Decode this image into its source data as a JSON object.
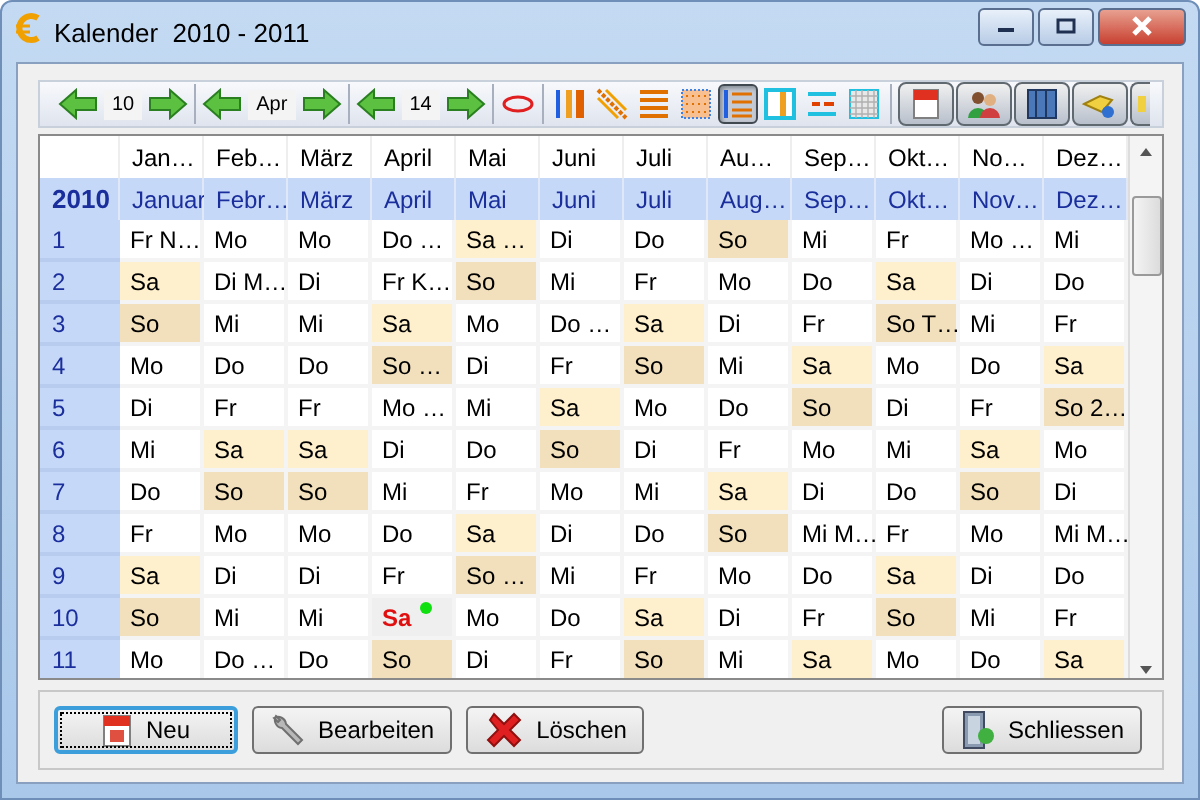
{
  "window": {
    "title": "Kalender  2010 - 2011"
  },
  "toolbar": {
    "navigators": [
      {
        "value": "10"
      },
      {
        "value": "Apr"
      },
      {
        "value": "14"
      }
    ],
    "views": [
      {
        "selected": false
      },
      {
        "selected": false
      },
      {
        "selected": false
      },
      {
        "selected": false
      },
      {
        "selected": true
      },
      {
        "selected": false
      },
      {
        "selected": false
      },
      {
        "selected": false
      }
    ]
  },
  "table": {
    "columns": [
      "Jan…",
      "Feb…",
      "März",
      "April",
      "Mai",
      "Juni",
      "Juli",
      "Au…",
      "Sep…",
      "Okt…",
      "No…",
      "Dez…"
    ],
    "year_row": {
      "year": "2010",
      "months": [
        "Januar",
        "Febr…",
        "März",
        "April",
        "Mai",
        "Juni",
        "Juli",
        "Aug…",
        "Sep…",
        "Okt…",
        "Nov…",
        "Dez…"
      ]
    },
    "rows": [
      {
        "day": "1",
        "cells": [
          {
            "text": "Fr N…",
            "kind": "day"
          },
          {
            "text": "Mo",
            "kind": "day"
          },
          {
            "text": "Mo",
            "kind": "day"
          },
          {
            "text": "Do …",
            "kind": "day"
          },
          {
            "text": "Sa …",
            "kind": "sat"
          },
          {
            "text": "Di",
            "kind": "day"
          },
          {
            "text": "Do",
            "kind": "day"
          },
          {
            "text": "So",
            "kind": "sun"
          },
          {
            "text": "Mi",
            "kind": "day"
          },
          {
            "text": "Fr",
            "kind": "day"
          },
          {
            "text": "Mo …",
            "kind": "day"
          },
          {
            "text": "Mi",
            "kind": "day"
          }
        ]
      },
      {
        "day": "2",
        "cells": [
          {
            "text": "Sa",
            "kind": "sat"
          },
          {
            "text": "Di M…",
            "kind": "day"
          },
          {
            "text": "Di",
            "kind": "day"
          },
          {
            "text": "Fr K…",
            "kind": "day"
          },
          {
            "text": "So",
            "kind": "sun"
          },
          {
            "text": "Mi",
            "kind": "day"
          },
          {
            "text": "Fr",
            "kind": "day"
          },
          {
            "text": "Mo",
            "kind": "day"
          },
          {
            "text": "Do",
            "kind": "day"
          },
          {
            "text": "Sa",
            "kind": "sat"
          },
          {
            "text": "Di",
            "kind": "day"
          },
          {
            "text": "Do",
            "kind": "day"
          }
        ]
      },
      {
        "day": "3",
        "cells": [
          {
            "text": "So",
            "kind": "sun"
          },
          {
            "text": "Mi",
            "kind": "day"
          },
          {
            "text": "Mi",
            "kind": "day"
          },
          {
            "text": "Sa",
            "kind": "sat"
          },
          {
            "text": "Mo",
            "kind": "day"
          },
          {
            "text": "Do …",
            "kind": "day"
          },
          {
            "text": "Sa",
            "kind": "sat"
          },
          {
            "text": "Di",
            "kind": "day"
          },
          {
            "text": "Fr",
            "kind": "day"
          },
          {
            "text": "So T…",
            "kind": "sun"
          },
          {
            "text": "Mi",
            "kind": "day"
          },
          {
            "text": "Fr",
            "kind": "day"
          }
        ]
      },
      {
        "day": "4",
        "cells": [
          {
            "text": "Mo",
            "kind": "day"
          },
          {
            "text": "Do",
            "kind": "day"
          },
          {
            "text": "Do",
            "kind": "day"
          },
          {
            "text": "So …",
            "kind": "sun"
          },
          {
            "text": "Di",
            "kind": "day"
          },
          {
            "text": "Fr",
            "kind": "day"
          },
          {
            "text": "So",
            "kind": "sun"
          },
          {
            "text": "Mi",
            "kind": "day"
          },
          {
            "text": "Sa",
            "kind": "sat"
          },
          {
            "text": "Mo",
            "kind": "day"
          },
          {
            "text": "Do",
            "kind": "day"
          },
          {
            "text": "Sa",
            "kind": "sat"
          }
        ]
      },
      {
        "day": "5",
        "cells": [
          {
            "text": "Di",
            "kind": "day"
          },
          {
            "text": "Fr",
            "kind": "day"
          },
          {
            "text": "Fr",
            "kind": "day"
          },
          {
            "text": "Mo …",
            "kind": "day"
          },
          {
            "text": "Mi",
            "kind": "day"
          },
          {
            "text": "Sa",
            "kind": "sat"
          },
          {
            "text": "Mo",
            "kind": "day"
          },
          {
            "text": "Do",
            "kind": "day"
          },
          {
            "text": "So",
            "kind": "sun"
          },
          {
            "text": "Di",
            "kind": "day"
          },
          {
            "text": "Fr",
            "kind": "day"
          },
          {
            "text": "So 2…",
            "kind": "sun"
          }
        ]
      },
      {
        "day": "6",
        "cells": [
          {
            "text": "Mi",
            "kind": "day"
          },
          {
            "text": "Sa",
            "kind": "sat"
          },
          {
            "text": "Sa",
            "kind": "sat"
          },
          {
            "text": "Di",
            "kind": "day"
          },
          {
            "text": "Do",
            "kind": "day"
          },
          {
            "text": "So",
            "kind": "sun"
          },
          {
            "text": "Di",
            "kind": "day"
          },
          {
            "text": "Fr",
            "kind": "day"
          },
          {
            "text": "Mo",
            "kind": "day"
          },
          {
            "text": "Mi",
            "kind": "day"
          },
          {
            "text": "Sa",
            "kind": "sat"
          },
          {
            "text": "Mo",
            "kind": "day"
          }
        ]
      },
      {
        "day": "7",
        "cells": [
          {
            "text": "Do",
            "kind": "day"
          },
          {
            "text": "So",
            "kind": "sun"
          },
          {
            "text": "So",
            "kind": "sun"
          },
          {
            "text": "Mi",
            "kind": "day"
          },
          {
            "text": "Fr",
            "kind": "day"
          },
          {
            "text": "Mo",
            "kind": "day"
          },
          {
            "text": "Mi",
            "kind": "day"
          },
          {
            "text": "Sa",
            "kind": "sat"
          },
          {
            "text": "Di",
            "kind": "day"
          },
          {
            "text": "Do",
            "kind": "day"
          },
          {
            "text": "So",
            "kind": "sun"
          },
          {
            "text": "Di",
            "kind": "day"
          }
        ]
      },
      {
        "day": "8",
        "cells": [
          {
            "text": "Fr",
            "kind": "day"
          },
          {
            "text": "Mo",
            "kind": "day"
          },
          {
            "text": "Mo",
            "kind": "day"
          },
          {
            "text": "Do",
            "kind": "day"
          },
          {
            "text": "Sa",
            "kind": "sat"
          },
          {
            "text": "Di",
            "kind": "day"
          },
          {
            "text": "Do",
            "kind": "day"
          },
          {
            "text": "So",
            "kind": "sun"
          },
          {
            "text": "Mi M…",
            "kind": "day"
          },
          {
            "text": "Fr",
            "kind": "day"
          },
          {
            "text": "Mo",
            "kind": "day"
          },
          {
            "text": "Mi M…",
            "kind": "day"
          }
        ]
      },
      {
        "day": "9",
        "cells": [
          {
            "text": "Sa",
            "kind": "sat"
          },
          {
            "text": "Di",
            "kind": "day"
          },
          {
            "text": "Di",
            "kind": "day"
          },
          {
            "text": "Fr",
            "kind": "day"
          },
          {
            "text": "So …",
            "kind": "sun"
          },
          {
            "text": "Mi",
            "kind": "day"
          },
          {
            "text": "Fr",
            "kind": "day"
          },
          {
            "text": "Mo",
            "kind": "day"
          },
          {
            "text": "Do",
            "kind": "day"
          },
          {
            "text": "Sa",
            "kind": "sat"
          },
          {
            "text": "Di",
            "kind": "day"
          },
          {
            "text": "Do",
            "kind": "day"
          }
        ]
      },
      {
        "day": "10",
        "cells": [
          {
            "text": "So",
            "kind": "sun"
          },
          {
            "text": "Mi",
            "kind": "day"
          },
          {
            "text": "Mi",
            "kind": "day"
          },
          {
            "text": "Sa",
            "kind": "today"
          },
          {
            "text": "Mo",
            "kind": "day"
          },
          {
            "text": "Do",
            "kind": "day"
          },
          {
            "text": "Sa",
            "kind": "sat"
          },
          {
            "text": "Di",
            "kind": "day"
          },
          {
            "text": "Fr",
            "kind": "day"
          },
          {
            "text": "So",
            "kind": "sun"
          },
          {
            "text": "Mi",
            "kind": "day"
          },
          {
            "text": "Fr",
            "kind": "day"
          }
        ]
      },
      {
        "day": "11",
        "cells": [
          {
            "text": "Mo",
            "kind": "day"
          },
          {
            "text": "Do …",
            "kind": "day"
          },
          {
            "text": "Do",
            "kind": "day"
          },
          {
            "text": "So",
            "kind": "sun"
          },
          {
            "text": "Di",
            "kind": "day"
          },
          {
            "text": "Fr",
            "kind": "day"
          },
          {
            "text": "So",
            "kind": "sun"
          },
          {
            "text": "Mi",
            "kind": "day"
          },
          {
            "text": "Sa",
            "kind": "sat"
          },
          {
            "text": "Mo",
            "kind": "day"
          },
          {
            "text": "Do",
            "kind": "day"
          },
          {
            "text": "Sa",
            "kind": "sat"
          }
        ]
      }
    ]
  },
  "buttons": [
    {
      "label": "Neu",
      "kind": "new",
      "focused": true
    },
    {
      "label": "Bearbeiten",
      "kind": "edit",
      "focused": false
    },
    {
      "label": "Löschen",
      "kind": "delete",
      "focused": false
    },
    {
      "label": "Schliessen",
      "kind": "close",
      "focused": false
    }
  ]
}
